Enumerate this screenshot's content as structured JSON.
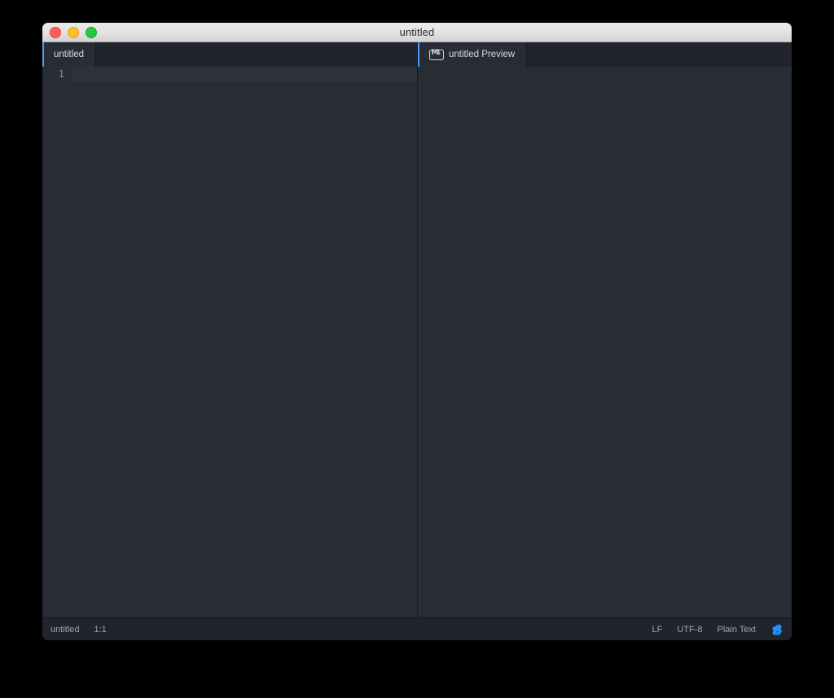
{
  "window": {
    "title": "untitled",
    "traffic_lights": [
      {
        "name": "close",
        "color": "#ff5f57"
      },
      {
        "name": "minimize",
        "color": "#febc2e"
      },
      {
        "name": "maximize",
        "color": "#28c840"
      }
    ]
  },
  "accent_color": "#4d9bf5",
  "editor_pane": {
    "tab": {
      "label": "untitled",
      "active": true
    },
    "lines": [
      {
        "number": "1",
        "text": ""
      }
    ],
    "cursor_position": "1:1"
  },
  "preview_pane": {
    "tab": {
      "label": "untitled Preview",
      "icon": "markdown-icon",
      "icon_text_left": "M",
      "icon_text_right": "↓",
      "active": true
    },
    "content": ""
  },
  "status_bar": {
    "left": [
      {
        "name": "file-name",
        "label": "untitled"
      },
      {
        "name": "cursor-position",
        "label": "1:1"
      }
    ],
    "right": [
      {
        "name": "line-ending",
        "label": "LF"
      },
      {
        "name": "encoding",
        "label": "UTF-8"
      },
      {
        "name": "grammar",
        "label": "Plain Text"
      }
    ],
    "git_icon": {
      "name": "squirrel-icon",
      "color": "#1e90ff"
    }
  }
}
